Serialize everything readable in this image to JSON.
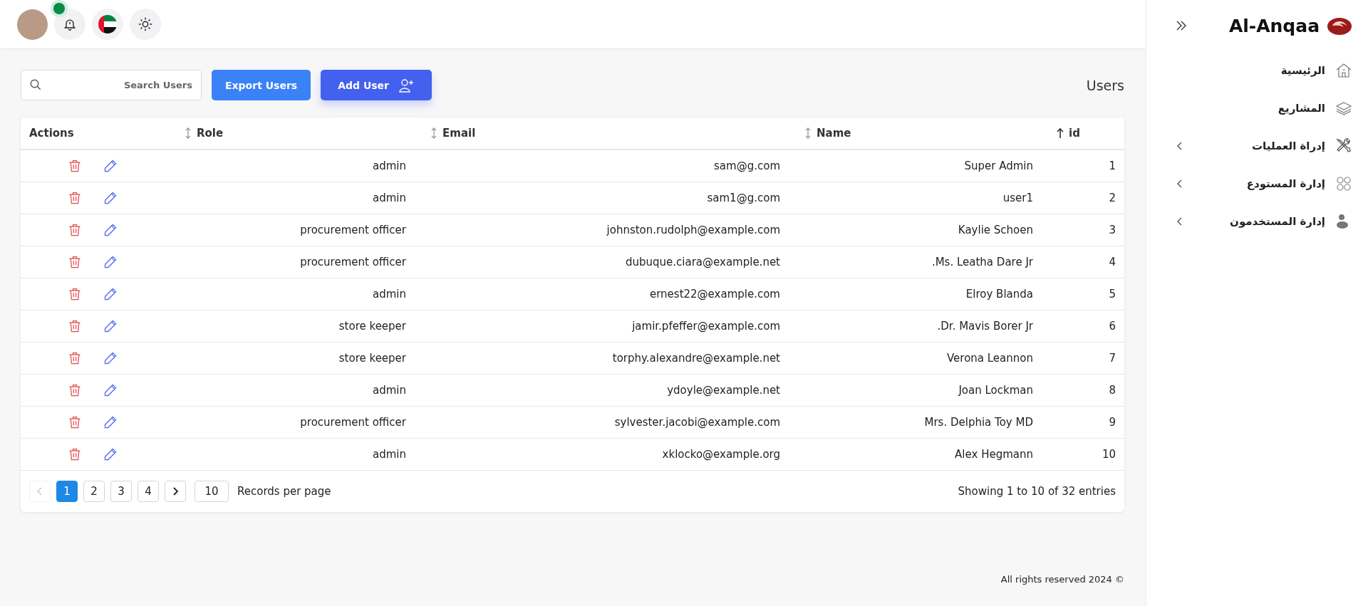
{
  "header": {
    "notification_dot": true
  },
  "toolbar": {
    "search": {
      "placeholder": "Search Users"
    },
    "export_button": "Export Users",
    "add_button": "Add User",
    "title": "Users"
  },
  "table": {
    "columns": [
      {
        "label": "Actions",
        "kind": "plain"
      },
      {
        "label": "Role",
        "kind": "sortable"
      },
      {
        "label": "Email",
        "kind": "sortable"
      },
      {
        "label": "Name",
        "kind": "sortable"
      },
      {
        "label": "id",
        "kind": "sorted"
      }
    ],
    "rows": [
      {
        "role": "admin",
        "email": "sam@g.com",
        "name": "Super Admin",
        "id": "1"
      },
      {
        "role": "admin",
        "email": "sam1@g.com",
        "name": "user1",
        "id": "2"
      },
      {
        "role": "procurement officer",
        "email": "johnston.rudolph@example.com",
        "name": "Kaylie Schoen",
        "id": "3"
      },
      {
        "role": "procurement officer",
        "email": "dubuque.ciara@example.net",
        "name": ".Ms. Leatha Dare Jr",
        "id": "4"
      },
      {
        "role": "admin",
        "email": "ernest22@example.com",
        "name": "Elroy Blanda",
        "id": "5"
      },
      {
        "role": "store keeper",
        "email": "jamir.pfeffer@example.com",
        "name": ".Dr. Mavis Borer Jr",
        "id": "6"
      },
      {
        "role": "store keeper",
        "email": "torphy.alexandre@example.net",
        "name": "Verona Leannon",
        "id": "7"
      },
      {
        "role": "admin",
        "email": "ydoyle@example.net",
        "name": "Joan Lockman",
        "id": "8"
      },
      {
        "role": "procurement officer",
        "email": "sylvester.jacobi@example.com",
        "name": "Mrs. Delphia Toy MD",
        "id": "9"
      },
      {
        "role": "admin",
        "email": "xklocko@example.org",
        "name": "Alex Hegmann",
        "id": "10"
      }
    ]
  },
  "pagination": {
    "prev_disabled": true,
    "pages": [
      {
        "label": "1",
        "selected": true
      },
      {
        "label": "2",
        "selected": false
      },
      {
        "label": "3",
        "selected": false
      },
      {
        "label": "4",
        "selected": false
      }
    ],
    "page_size": "10",
    "page_size_label": "Records per page",
    "summary": "Showing 1 to 10 of 32 entries"
  },
  "footer": "All rights reserved 2024 ©",
  "sidebar": {
    "brand": "Al-Anqaa",
    "items": [
      {
        "label": "الرئيسية",
        "kind": "home",
        "expandable": false
      },
      {
        "label": "المشاريع",
        "kind": "layers",
        "expandable": false
      },
      {
        "label": "إدراة العمليات",
        "kind": "tools",
        "expandable": true
      },
      {
        "label": "إدارة المستودع",
        "kind": "grid",
        "expandable": true
      },
      {
        "label": "إدارة المستخدمون",
        "kind": "users",
        "expandable": true
      }
    ]
  }
}
